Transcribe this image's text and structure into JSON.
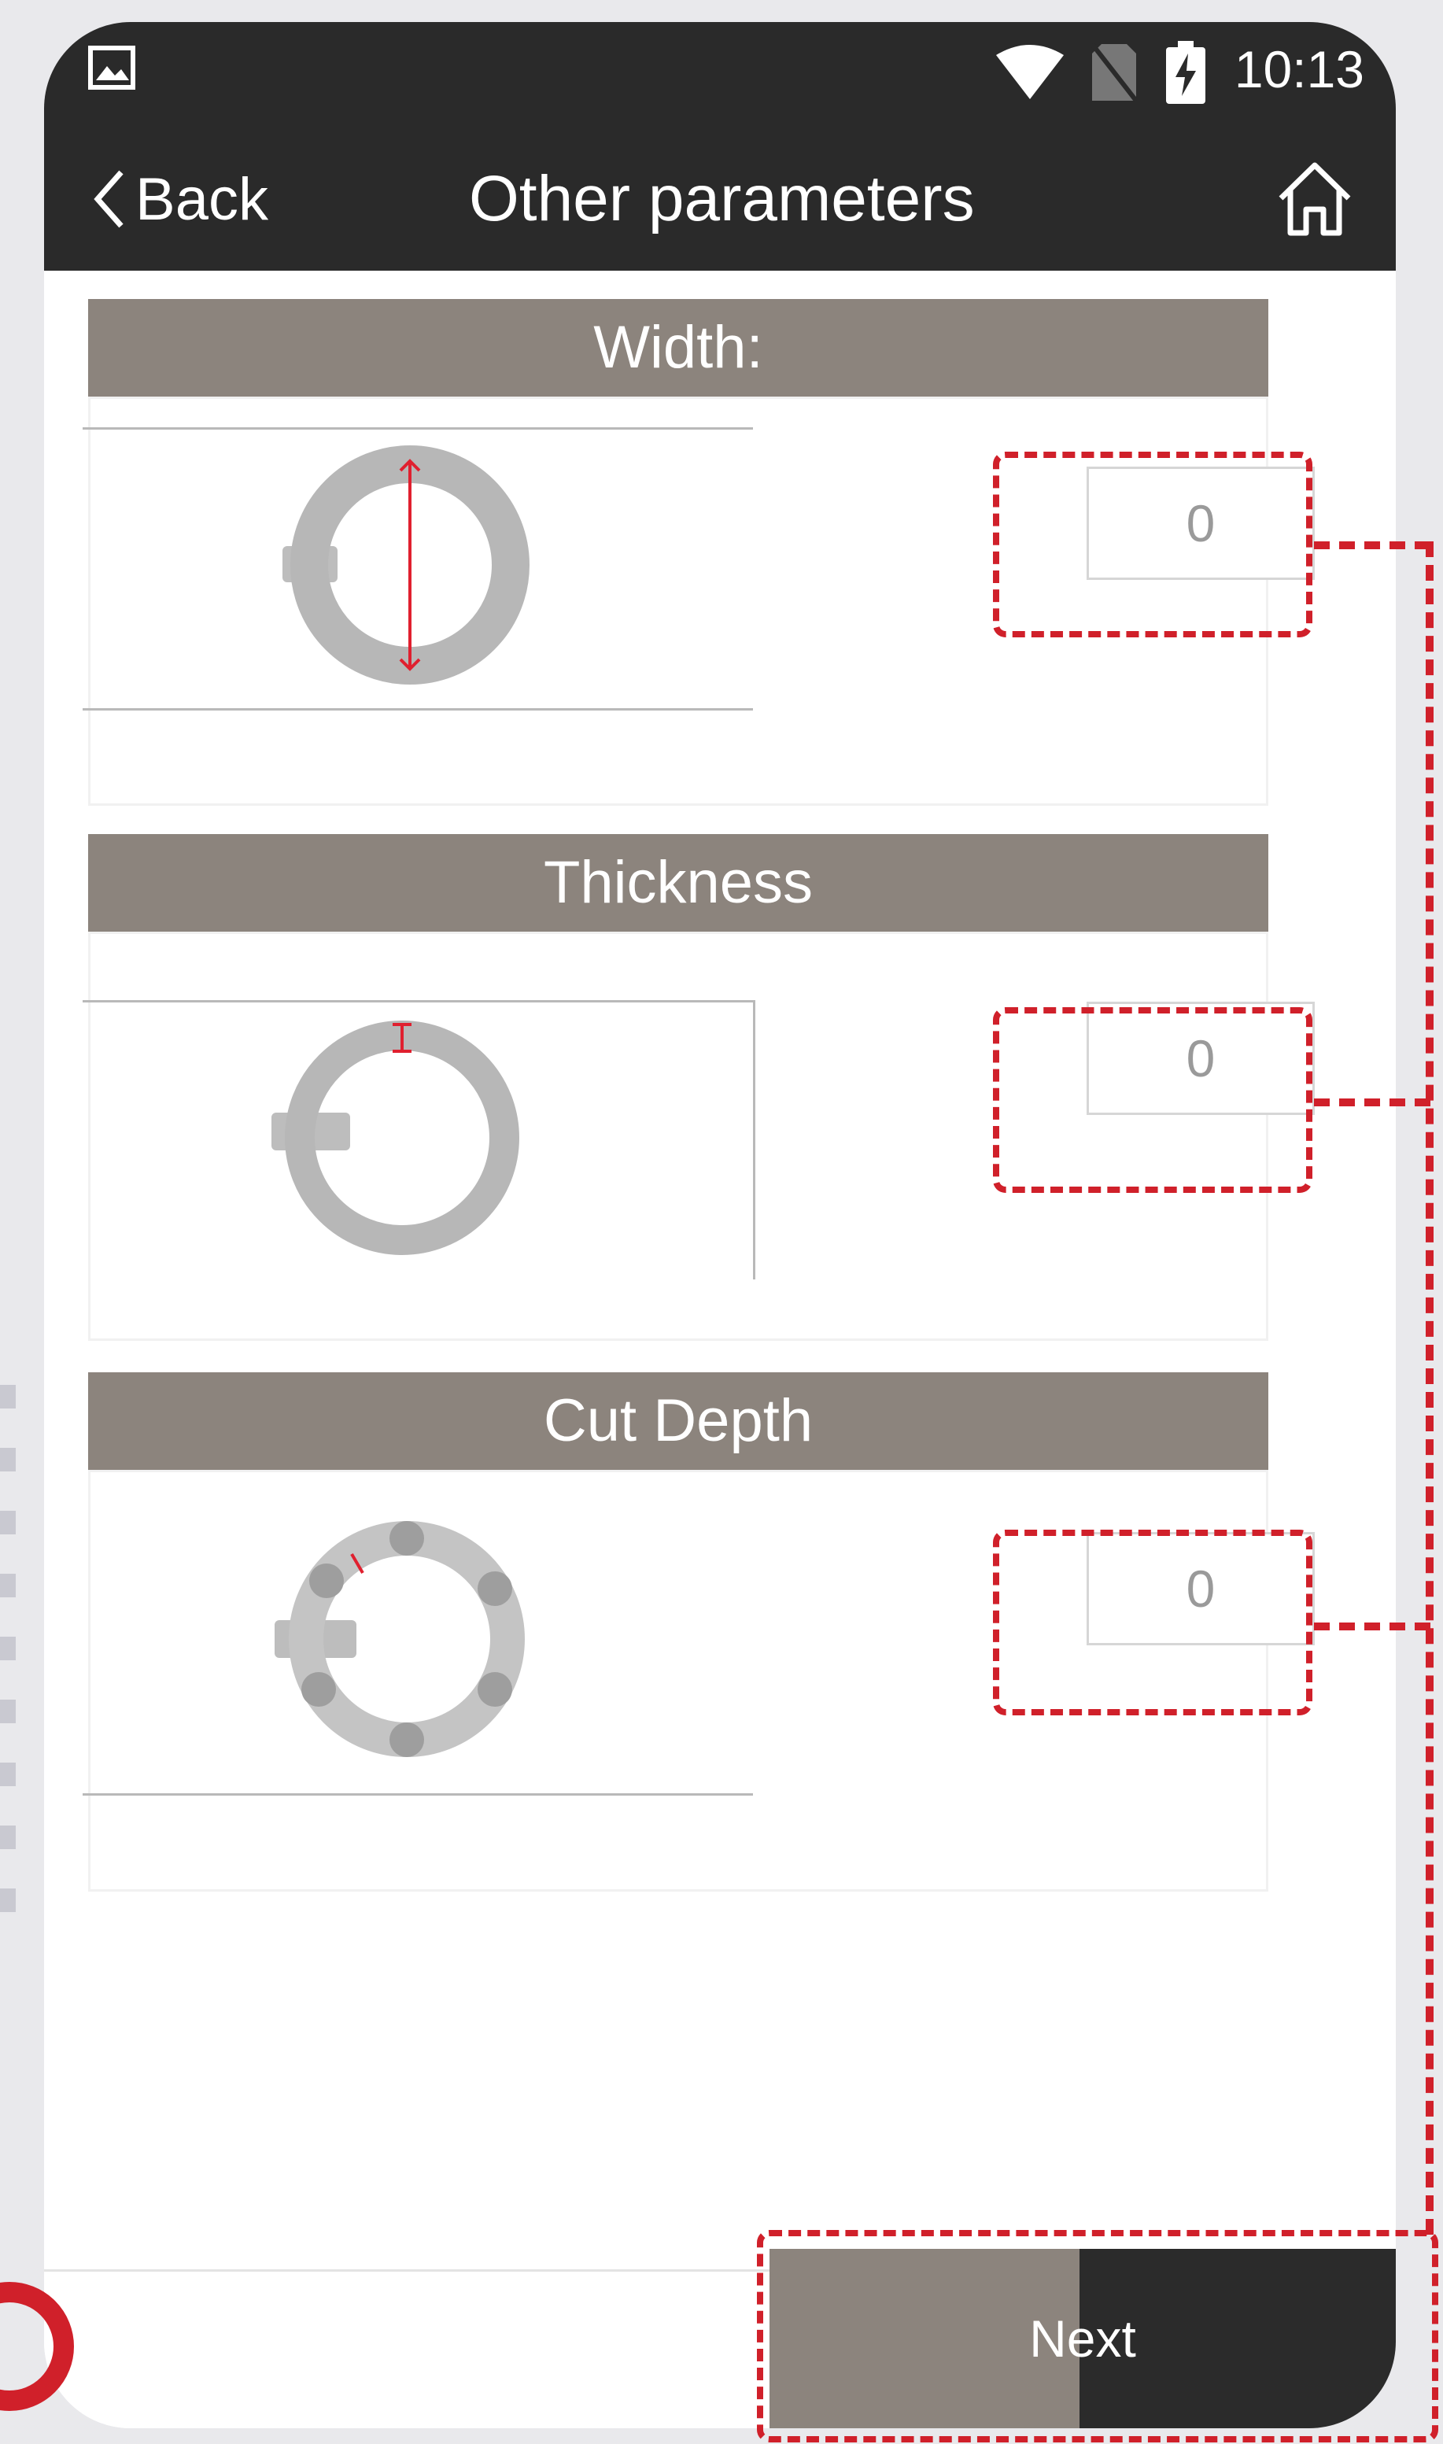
{
  "status_bar": {
    "time": "10:13"
  },
  "header": {
    "back_label": "Back",
    "title": "Other parameters"
  },
  "sections": [
    {
      "title": "Width:",
      "value": "0"
    },
    {
      "title": "Thickness",
      "value": "0"
    },
    {
      "title": "Cut Depth",
      "value": "0"
    }
  ],
  "footer": {
    "next_label": "Next"
  },
  "colors": {
    "topbar": "#2a2a2a",
    "section_header": "#8c847d",
    "annotation_red": "#d0202a",
    "next_left": "#8c847d",
    "next_right": "#2b2b2b"
  },
  "icons": [
    "gallery-icon",
    "wifi-icon",
    "no-sim-icon",
    "battery-charging-icon",
    "chevron-left-icon",
    "home-icon"
  ]
}
